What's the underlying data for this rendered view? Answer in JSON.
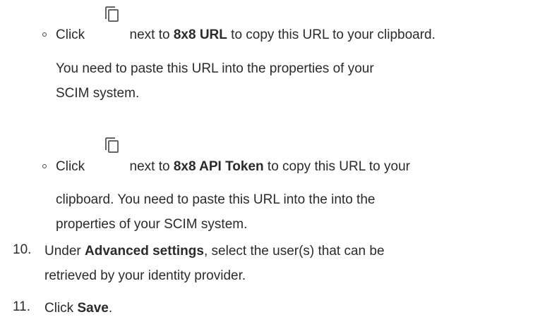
{
  "items": [
    {
      "type": "sub-bullet",
      "pre": "Click",
      "mid": "next to",
      "bold": "8x8 URL",
      "post": "to copy this URL to your clipboard.",
      "line2": "You need to paste this URL into the properties of your",
      "line3": "SCIM system."
    },
    {
      "type": "sub-bullet",
      "pre": "Click",
      "mid": "next to",
      "bold": "8x8 API Token",
      "post": "to copy this URL to your",
      "line2": "clipboard. You need to paste this URL into the into the",
      "line3": "properties of your SCIM system."
    },
    {
      "type": "step",
      "number": "10.",
      "pre": "Under",
      "bold": "Advanced settings",
      "post": ", select the user(s) that can be",
      "line2": "retrieved by your identity provider."
    },
    {
      "type": "step",
      "number": "11.",
      "pre": "Click",
      "bold": "Save",
      "post": "."
    }
  ],
  "icons": {
    "copy": "copy-icon"
  }
}
